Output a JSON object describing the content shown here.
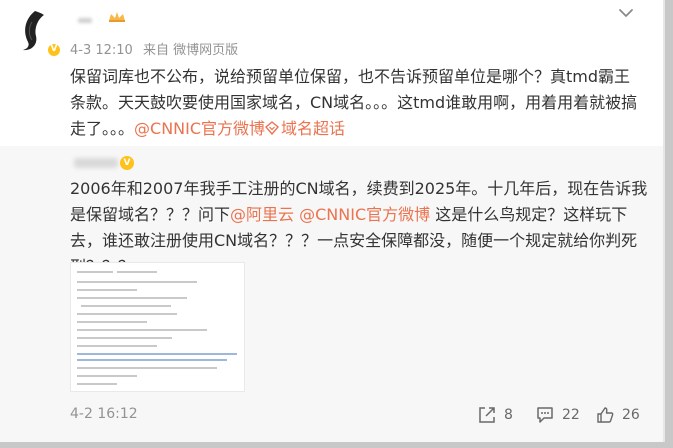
{
  "post": {
    "author_name": "",
    "time": "4-3 12:10",
    "source": "来自 微博网页版",
    "text_before": "保留词库也不公布，说给预留单位保留，也不告诉预留单位是哪个？真tmd霸王条款。天天鼓吹要使用国家域名，CN域名。。。这tmd谁敢用啊，用着用着就被搞走了。。。",
    "mention": "@CNNIC官方微博",
    "super_topic": "域名超话"
  },
  "repost": {
    "author_name": "",
    "text_a": "2006年和2007年我手工注册的CN域名，续费到2025年。十几年后，现在告诉我是保留域名？？？问下",
    "mention1": "@阿里云",
    "mention2": "@CNNIC官方微博",
    "text_b": " 这是什么鸟规定？这样玩下去，谁还敢注册使用CN域名？？？一点安全保障都没，随便一个规定就给你判死刑？？？",
    "time": "4-2 16:12",
    "actions": {
      "share_count": "8",
      "comment_count": "22",
      "like_count": "26"
    }
  },
  "icons": {
    "verified": "verified-v-icon",
    "more": "chevron-down-icon",
    "share": "share-icon",
    "comment": "comment-icon",
    "like": "thumbs-up-icon",
    "super_topic": "super-topic-icon"
  },
  "colors": {
    "link": "#eb7350",
    "meta": "#939393",
    "verified_badge": "#ffc21a",
    "repost_background": "#f7f7f7"
  }
}
